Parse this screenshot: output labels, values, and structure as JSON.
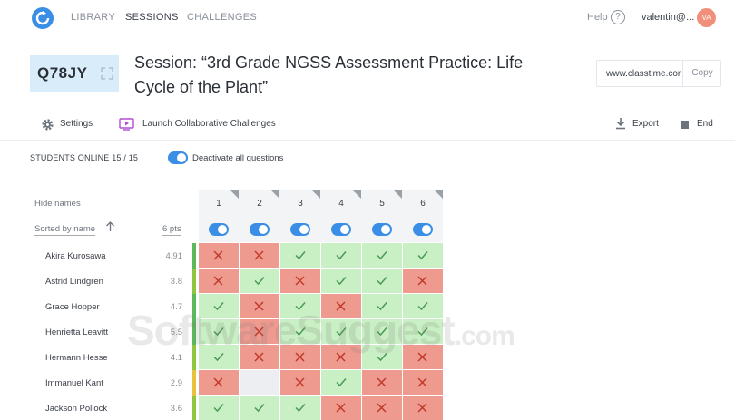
{
  "nav": {
    "items": [
      "LIBRARY",
      "SESSIONS",
      "CHALLENGES"
    ],
    "active": "SESSIONS",
    "help": "Help",
    "user": "valentin@...",
    "avatar_initials": "VA"
  },
  "session": {
    "code": "Q78JY",
    "title": "Session: “3rd Grade NGSS Assessment Practice: Life Cycle of the Plant”",
    "url": "www.classtime.com",
    "copy_label": "Copy"
  },
  "toolbar": {
    "settings": "Settings",
    "launch": "Launch Collaborative Challenges",
    "export": "Export",
    "end": "End"
  },
  "status": {
    "students_online": "STUDENTS ONLINE 15 / 15",
    "deactivate_label": "Deactivate all questions"
  },
  "list": {
    "hide_names": "Hide names",
    "sorted_by": "Sorted by name",
    "pts": "6 pts"
  },
  "questions": [
    "1",
    "2",
    "3",
    "4",
    "5",
    "6"
  ],
  "students": [
    {
      "name": "Akira Kurosawa",
      "score": "4.91",
      "bar": "#5cb85c",
      "results": [
        "wrong",
        "wrong",
        "correct",
        "correct",
        "correct",
        "correct"
      ]
    },
    {
      "name": "Astrid Lindgren",
      "score": "3.8",
      "bar": "#8ec63f",
      "results": [
        "wrong",
        "correct",
        "wrong",
        "correct",
        "correct",
        "wrong"
      ]
    },
    {
      "name": "Grace Hopper",
      "score": "4.7",
      "bar": "#5cb85c",
      "results": [
        "correct",
        "wrong",
        "correct",
        "wrong",
        "correct",
        "correct"
      ]
    },
    {
      "name": "Henrietta Leavitt",
      "score": "5.5",
      "bar": "#5cb85c",
      "results": [
        "correct",
        "wrong",
        "correct",
        "correct",
        "correct",
        "correct"
      ]
    },
    {
      "name": "Hermann Hesse",
      "score": "4.1",
      "bar": "#8ec63f",
      "results": [
        "correct",
        "wrong",
        "wrong",
        "wrong",
        "correct",
        "wrong"
      ]
    },
    {
      "name": "Immanuel Kant",
      "score": "2.9",
      "bar": "#e8c23a",
      "results": [
        "wrong",
        "blank",
        "wrong",
        "correct",
        "wrong",
        "wrong"
      ]
    },
    {
      "name": "Jackson Pollock",
      "score": "3.6",
      "bar": "#8ec63f",
      "results": [
        "correct",
        "correct",
        "correct",
        "wrong",
        "wrong",
        "wrong"
      ]
    }
  ],
  "watermark": {
    "main": "SoftwareSuggest",
    "suffix": ".com"
  },
  "colors": {
    "accent": "#3a8ee6",
    "correct": "#c9efc4",
    "wrong": "#ee9a8f",
    "avatar": "#f08f7a"
  }
}
